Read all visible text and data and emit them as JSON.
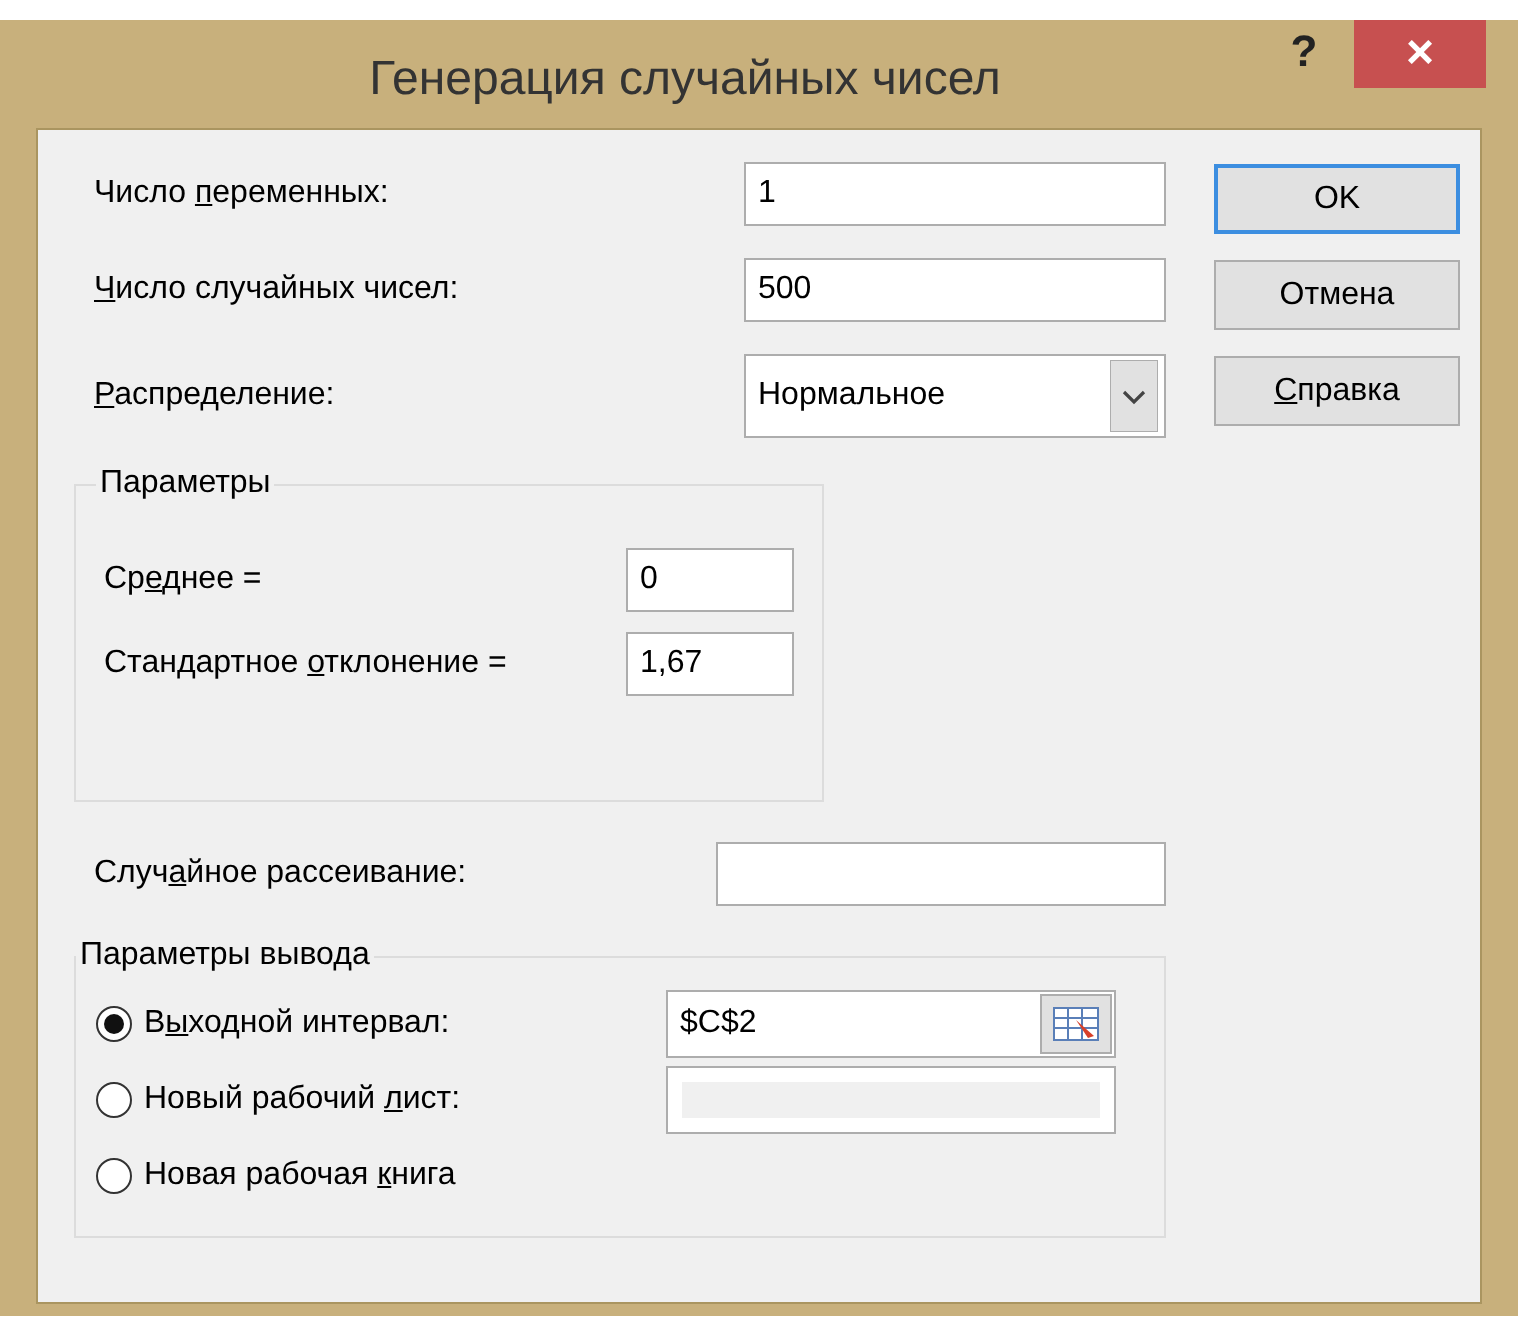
{
  "window": {
    "title": "Генерация случайных чисел",
    "help_button": "?",
    "close_button": "×"
  },
  "inputs": [
    {
      "label": {
        "pre": "Число ",
        "key": "п",
        "post": "еременных:"
      },
      "value": "1"
    },
    {
      "label": {
        "key": "Ч",
        "post": "исло случайных чисел:"
      },
      "value": "500"
    }
  ],
  "distribution": {
    "label": {
      "key": "Р",
      "post": "аспределение:"
    },
    "value": "Нормальное"
  },
  "buttons": [
    {
      "label": {
        "post": "OK"
      },
      "default": true
    },
    {
      "label": {
        "post": "Отмена"
      },
      "default": false
    },
    {
      "label": {
        "key": "С",
        "post": "правка"
      },
      "default": false
    }
  ],
  "parameters": {
    "legend": "Параметры",
    "fields": [
      {
        "label": {
          "pre": "Ср",
          "key": "е",
          "post": "днее ="
        },
        "value": "0"
      },
      {
        "label": {
          "pre": "Стандартное ",
          "key": "о",
          "post": "тклонение ="
        },
        "value": "1,67"
      }
    ]
  },
  "random_seed": {
    "label": {
      "pre": "Случ",
      "key": "а",
      "post": "йное рассеивание:"
    }
  },
  "output": {
    "legend": "Параметры вывода",
    "options": [
      {
        "label": {
          "pre": "В",
          "key": "ы",
          "post": "ходной интервал:"
        },
        "selected": true,
        "field": {
          "value": "$C$2",
          "disabled": false,
          "picker": true
        }
      },
      {
        "label": {
          "pre": "Новый рабочий ",
          "key": "л",
          "post": "ист:"
        },
        "selected": false,
        "field": {
          "disabled": true,
          "picker": false
        }
      },
      {
        "label": {
          "pre": "Новая рабочая ",
          "key": "к",
          "post": "нига"
        },
        "selected": false
      }
    ]
  }
}
